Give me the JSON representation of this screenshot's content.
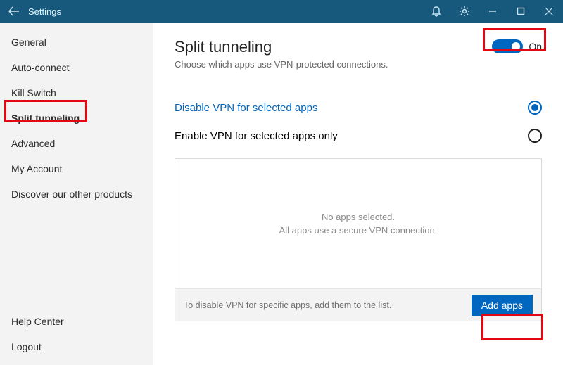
{
  "titlebar": {
    "title": "Settings"
  },
  "sidebar": {
    "items": [
      {
        "label": "General"
      },
      {
        "label": "Auto-connect"
      },
      {
        "label": "Kill Switch"
      },
      {
        "label": "Split tunneling",
        "active": true
      },
      {
        "label": "Advanced"
      },
      {
        "label": "My Account"
      },
      {
        "label": "Discover our other products"
      }
    ],
    "bottom": [
      {
        "label": "Help Center"
      },
      {
        "label": "Logout"
      }
    ]
  },
  "main": {
    "title": "Split tunneling",
    "subtitle": "Choose which apps use VPN-protected connections.",
    "toggle": {
      "state": "On"
    },
    "options": [
      {
        "label": "Disable VPN for selected apps",
        "selected": true
      },
      {
        "label": "Enable VPN for selected apps only",
        "selected": false
      }
    ],
    "empty": {
      "line1": "No apps selected.",
      "line2": "All apps use a secure VPN connection."
    },
    "footer": {
      "hint": "To disable VPN for specific apps, add them to the list.",
      "button": "Add apps"
    }
  }
}
